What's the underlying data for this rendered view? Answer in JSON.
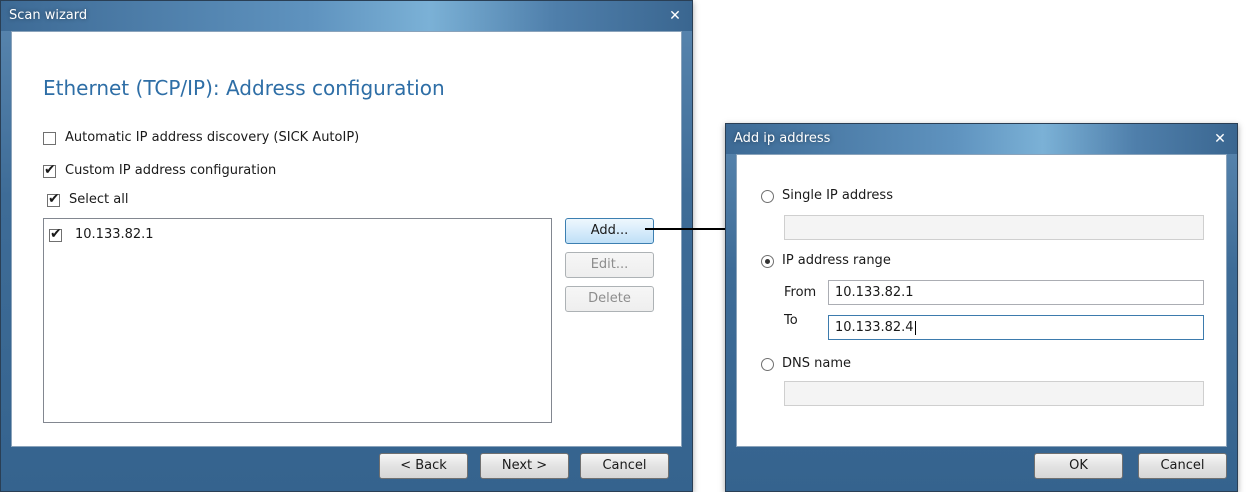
{
  "scan_wizard": {
    "title": "Scan wizard",
    "close": "✕",
    "heading": "Ethernet (TCP/IP): Address configuration",
    "auto_ip_label": "Automatic IP address discovery (SICK AutoIP)",
    "auto_ip_checked": false,
    "custom_ip_label": "Custom IP address configuration",
    "custom_ip_checked": true,
    "select_all_label": "Select all",
    "addresses": [
      {
        "value": "10.133.82.1",
        "checked": true
      }
    ],
    "add_button": "Add...",
    "edit_button": "Edit...",
    "delete_button": "Delete",
    "back_button": "< Back",
    "next_button": "Next >",
    "cancel_button": "Cancel"
  },
  "add_ip_dialog": {
    "title": "Add ip address",
    "close": "✕",
    "single_ip_label": "Single IP address",
    "single_ip_value": "",
    "range_label": "IP address range",
    "selected_option": "IP address range",
    "from_label": "From",
    "from_value": "10.133.82.1",
    "to_label": "To",
    "to_value": "10.133.82.4",
    "dns_label": "DNS name",
    "dns_value": "",
    "ok_button": "OK",
    "cancel_button": "Cancel"
  },
  "colors": {
    "heading": "#2e6ea6",
    "titlebar": "#4f84b3",
    "arrow": "#000000"
  }
}
